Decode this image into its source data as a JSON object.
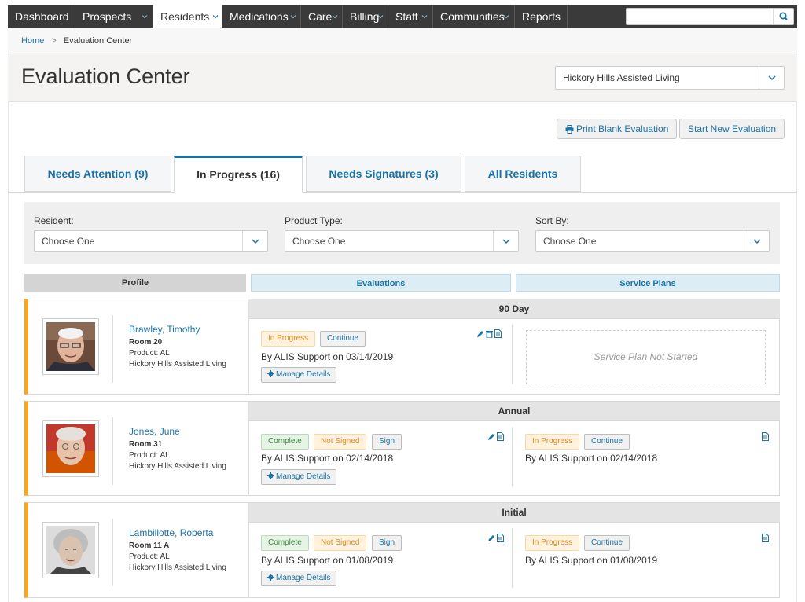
{
  "nav": {
    "items": [
      "Dashboard",
      "Prospects",
      "Residents",
      "Medications",
      "Care",
      "Billing",
      "Staff",
      "Communities",
      "Reports"
    ],
    "active": "Residents",
    "search_placeholder": ""
  },
  "breadcrumb": {
    "home": "Home",
    "current": "Evaluation Center"
  },
  "header": {
    "title": "Evaluation Center",
    "community": "Hickory Hills Assisted Living"
  },
  "actions": {
    "print_label": "Print Blank Evaluation",
    "new_label": "Start New Evaluation"
  },
  "tabs": [
    {
      "label": "Needs Attention (9)"
    },
    {
      "label": "In Progress (16)"
    },
    {
      "label": "Needs Signatures (3)"
    },
    {
      "label": "All Residents"
    }
  ],
  "filters": {
    "resident": {
      "label": "Resident:",
      "value": "Choose One"
    },
    "product": {
      "label": "Product Type:",
      "value": "Choose One"
    },
    "sort": {
      "label": "Sort By:",
      "value": "Choose One"
    }
  },
  "columns": {
    "profile": "Profile",
    "evaluations": "Evaluations",
    "service_plans": "Service Plans"
  },
  "residents": [
    {
      "name": "Brawley, Timothy",
      "room": "Room 20",
      "product": "Product: AL",
      "community": "Hickory Hills Assisted Living",
      "eval_type": "90 Day",
      "eval_status": "In Progress",
      "eval_action": "Continue",
      "eval_by": "By ALIS Support on 03/14/2019",
      "manage_label": "Manage Details",
      "service_plan_empty": "Service Plan Not Started"
    },
    {
      "name": "Jones, June",
      "room": "Room 31",
      "product": "Product: AL",
      "community": "Hickory Hills Assisted Living",
      "eval_type": "Annual",
      "eval_status": "Complete",
      "eval_sign_status": "Not Signed",
      "eval_action": "Sign",
      "eval_by": "By ALIS Support on 02/14/2018",
      "manage_label": "Manage Details",
      "sp_status": "In Progress",
      "sp_action": "Continue",
      "sp_by": "By ALIS Support on 02/14/2018"
    },
    {
      "name": "Lambillotte, Roberta",
      "room": "Room 11 A",
      "product": "Product: AL",
      "community": "Hickory Hills Assisted Living",
      "eval_type": "Initial",
      "eval_status": "Complete",
      "eval_sign_status": "Not Signed",
      "eval_action": "Sign",
      "eval_by": "By ALIS Support on 01/08/2019",
      "manage_label": "Manage Details",
      "sp_status": "In Progress",
      "sp_action": "Continue",
      "sp_by": "By ALIS Support on 01/08/2019"
    }
  ],
  "colors": {
    "accent": "#1a73a8",
    "warning": "#f5a623",
    "nav_bg": "#3a3a3a"
  }
}
